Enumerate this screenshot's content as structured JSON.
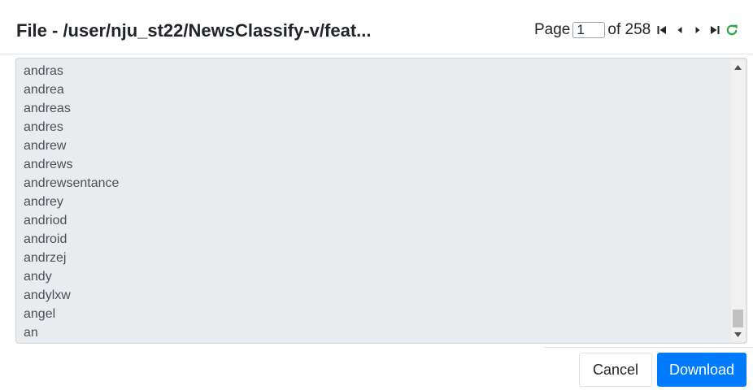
{
  "header": {
    "title": "File - /user/nju_st22/NewsClassify-v/feat...",
    "pager": {
      "page_label": "Page",
      "page_value": "1",
      "of_label": "of 258"
    }
  },
  "icons": {
    "first": "first-page-icon",
    "prev": "previous-page-icon",
    "next": "next-page-icon",
    "last": "last-page-icon",
    "refresh": "refresh-icon"
  },
  "colors": {
    "refresh": "#28a745",
    "download": "#007bff",
    "content_bg": "#e9ecef"
  },
  "content": {
    "lines": [
      "andras",
      "andrea",
      "andreas",
      "andres",
      "andrew",
      "andrews",
      "andrewsentance",
      "andrey",
      "andriod",
      "android",
      "andrzej",
      "andy",
      "andylxw",
      "angel",
      "an"
    ]
  },
  "footer": {
    "cancel_label": "Cancel",
    "download_label": "Download"
  }
}
